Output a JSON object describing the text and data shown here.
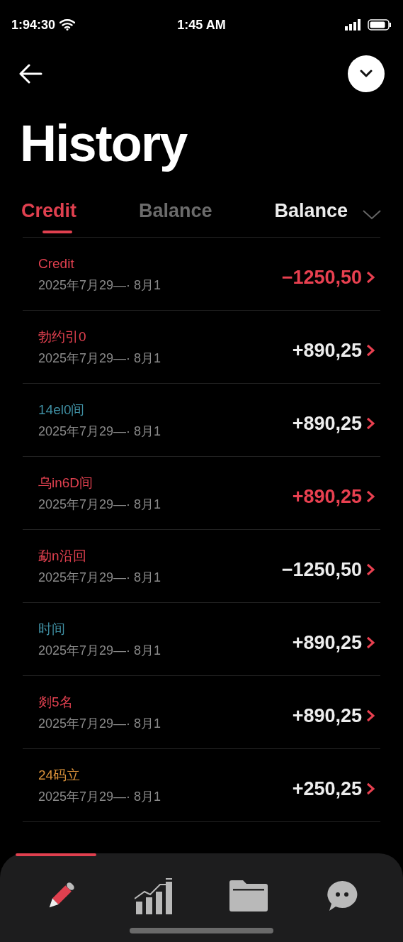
{
  "status_bar": {
    "left_time": "1:94:30",
    "time": "1:45 AM"
  },
  "title": "History",
  "tabs": [
    {
      "label": "Credit",
      "selected": true,
      "muted": false
    },
    {
      "label": "Balance",
      "selected": false,
      "muted": true
    },
    {
      "label": "Balance",
      "selected": false,
      "muted": false
    }
  ],
  "transactions": [
    {
      "label": "Credit",
      "color": "#e0404f",
      "date": "2025年7月29—· 8月1",
      "amount": "−1250,50",
      "highlighted": true
    },
    {
      "label": "勃约引0",
      "color": "#e0404f",
      "date": "2025年7月29—· 8月1",
      "amount": "+890,25",
      "highlighted": false
    },
    {
      "label": "14el0间",
      "color": "#3f8fa3",
      "date": "2025年7月29—· 8月1",
      "amount": "+890,25",
      "highlighted": false
    },
    {
      "label": "乌in6D间",
      "color": "#e0404f",
      "date": "2025年7月29—· 8月1",
      "amount": "+890,25",
      "highlighted": true
    },
    {
      "label": "勐n沿回",
      "color": "#e0404f",
      "date": "2025年7月29—· 8月1",
      "amount": "−1250,50",
      "highlighted": false
    },
    {
      "label": "时间",
      "color": "#3f8fa3",
      "date": "2025年7月29—· 8月1",
      "amount": "+890,25",
      "highlighted": false
    },
    {
      "label": "剡5名",
      "color": "#e0404f",
      "date": "2025年7月29—· 8月1",
      "amount": "+890,25",
      "highlighted": false
    },
    {
      "label": "24码立",
      "color": "#d9913a",
      "date": "2025年7月29—· 8月1",
      "amount": "+250,25",
      "highlighted": false
    }
  ],
  "bottom_nav": [
    {
      "kind": "pencil",
      "selected": true
    },
    {
      "kind": "chart",
      "selected": false
    },
    {
      "kind": "folder",
      "selected": false
    },
    {
      "kind": "chat",
      "selected": false
    }
  ]
}
